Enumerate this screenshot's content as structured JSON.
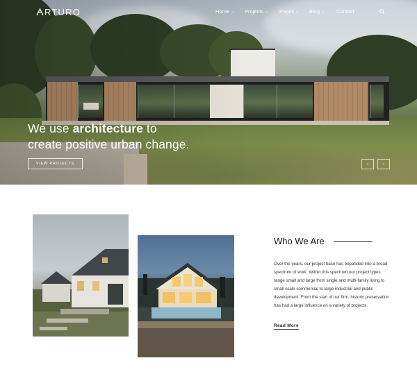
{
  "brand": {
    "logo_text": "RTURO",
    "logo_mark": "A"
  },
  "nav": {
    "items": [
      {
        "label": "Home",
        "has_dropdown": true
      },
      {
        "label": "Projects",
        "has_dropdown": true
      },
      {
        "label": "Pages",
        "has_dropdown": true
      },
      {
        "label": "Blog",
        "has_dropdown": true
      },
      {
        "label": "Contact",
        "has_dropdown": false
      }
    ],
    "search_icon": "search-icon"
  },
  "hero": {
    "headline_pre": "We use ",
    "headline_bold": "architecture",
    "headline_post": " to",
    "headline_line2": "create positive urban change.",
    "cta_label": "VIEW PROJECTS",
    "prev_icon": "chevron-left-icon",
    "next_icon": "chevron-right-icon"
  },
  "about": {
    "title": "Who We Are",
    "body": "Over the years, our project base has expanded into a broad spectrum of work. Within this spectrum our project types range small and large from single and multi-family living to small scale commercial to large industrial and public development. From the start of our firm, historic preservation has had a large influence on a variety of projects.",
    "read_more": "Read More"
  },
  "colors": {
    "accent": "#222222",
    "text_light": "#ffffff",
    "body_text": "#333333"
  }
}
